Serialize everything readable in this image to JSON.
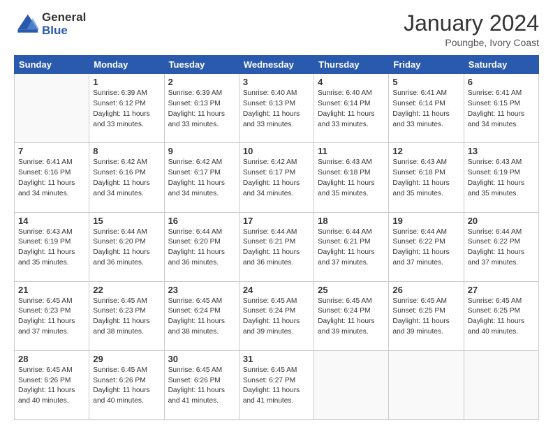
{
  "logo": {
    "general": "General",
    "blue": "Blue"
  },
  "title": "January 2024",
  "location": "Poungbe, Ivory Coast",
  "days_of_week": [
    "Sunday",
    "Monday",
    "Tuesday",
    "Wednesday",
    "Thursday",
    "Friday",
    "Saturday"
  ],
  "weeks": [
    [
      {
        "day": "",
        "info": ""
      },
      {
        "day": "1",
        "info": "Sunrise: 6:39 AM\nSunset: 6:12 PM\nDaylight: 11 hours\nand 33 minutes."
      },
      {
        "day": "2",
        "info": "Sunrise: 6:39 AM\nSunset: 6:13 PM\nDaylight: 11 hours\nand 33 minutes."
      },
      {
        "day": "3",
        "info": "Sunrise: 6:40 AM\nSunset: 6:13 PM\nDaylight: 11 hours\nand 33 minutes."
      },
      {
        "day": "4",
        "info": "Sunrise: 6:40 AM\nSunset: 6:14 PM\nDaylight: 11 hours\nand 33 minutes."
      },
      {
        "day": "5",
        "info": "Sunrise: 6:41 AM\nSunset: 6:14 PM\nDaylight: 11 hours\nand 33 minutes."
      },
      {
        "day": "6",
        "info": "Sunrise: 6:41 AM\nSunset: 6:15 PM\nDaylight: 11 hours\nand 34 minutes."
      }
    ],
    [
      {
        "day": "7",
        "info": "Sunrise: 6:41 AM\nSunset: 6:16 PM\nDaylight: 11 hours\nand 34 minutes."
      },
      {
        "day": "8",
        "info": "Sunrise: 6:42 AM\nSunset: 6:16 PM\nDaylight: 11 hours\nand 34 minutes."
      },
      {
        "day": "9",
        "info": "Sunrise: 6:42 AM\nSunset: 6:17 PM\nDaylight: 11 hours\nand 34 minutes."
      },
      {
        "day": "10",
        "info": "Sunrise: 6:42 AM\nSunset: 6:17 PM\nDaylight: 11 hours\nand 34 minutes."
      },
      {
        "day": "11",
        "info": "Sunrise: 6:43 AM\nSunset: 6:18 PM\nDaylight: 11 hours\nand 35 minutes."
      },
      {
        "day": "12",
        "info": "Sunrise: 6:43 AM\nSunset: 6:18 PM\nDaylight: 11 hours\nand 35 minutes."
      },
      {
        "day": "13",
        "info": "Sunrise: 6:43 AM\nSunset: 6:19 PM\nDaylight: 11 hours\nand 35 minutes."
      }
    ],
    [
      {
        "day": "14",
        "info": "Sunrise: 6:43 AM\nSunset: 6:19 PM\nDaylight: 11 hours\nand 35 minutes."
      },
      {
        "day": "15",
        "info": "Sunrise: 6:44 AM\nSunset: 6:20 PM\nDaylight: 11 hours\nand 36 minutes."
      },
      {
        "day": "16",
        "info": "Sunrise: 6:44 AM\nSunset: 6:20 PM\nDaylight: 11 hours\nand 36 minutes."
      },
      {
        "day": "17",
        "info": "Sunrise: 6:44 AM\nSunset: 6:21 PM\nDaylight: 11 hours\nand 36 minutes."
      },
      {
        "day": "18",
        "info": "Sunrise: 6:44 AM\nSunset: 6:21 PM\nDaylight: 11 hours\nand 37 minutes."
      },
      {
        "day": "19",
        "info": "Sunrise: 6:44 AM\nSunset: 6:22 PM\nDaylight: 11 hours\nand 37 minutes."
      },
      {
        "day": "20",
        "info": "Sunrise: 6:44 AM\nSunset: 6:22 PM\nDaylight: 11 hours\nand 37 minutes."
      }
    ],
    [
      {
        "day": "21",
        "info": "Sunrise: 6:45 AM\nSunset: 6:23 PM\nDaylight: 11 hours\nand 37 minutes."
      },
      {
        "day": "22",
        "info": "Sunrise: 6:45 AM\nSunset: 6:23 PM\nDaylight: 11 hours\nand 38 minutes."
      },
      {
        "day": "23",
        "info": "Sunrise: 6:45 AM\nSunset: 6:24 PM\nDaylight: 11 hours\nand 38 minutes."
      },
      {
        "day": "24",
        "info": "Sunrise: 6:45 AM\nSunset: 6:24 PM\nDaylight: 11 hours\nand 39 minutes."
      },
      {
        "day": "25",
        "info": "Sunrise: 6:45 AM\nSunset: 6:24 PM\nDaylight: 11 hours\nand 39 minutes."
      },
      {
        "day": "26",
        "info": "Sunrise: 6:45 AM\nSunset: 6:25 PM\nDaylight: 11 hours\nand 39 minutes."
      },
      {
        "day": "27",
        "info": "Sunrise: 6:45 AM\nSunset: 6:25 PM\nDaylight: 11 hours\nand 40 minutes."
      }
    ],
    [
      {
        "day": "28",
        "info": "Sunrise: 6:45 AM\nSunset: 6:26 PM\nDaylight: 11 hours\nand 40 minutes."
      },
      {
        "day": "29",
        "info": "Sunrise: 6:45 AM\nSunset: 6:26 PM\nDaylight: 11 hours\nand 40 minutes."
      },
      {
        "day": "30",
        "info": "Sunrise: 6:45 AM\nSunset: 6:26 PM\nDaylight: 11 hours\nand 41 minutes."
      },
      {
        "day": "31",
        "info": "Sunrise: 6:45 AM\nSunset: 6:27 PM\nDaylight: 11 hours\nand 41 minutes."
      },
      {
        "day": "",
        "info": ""
      },
      {
        "day": "",
        "info": ""
      },
      {
        "day": "",
        "info": ""
      }
    ]
  ]
}
